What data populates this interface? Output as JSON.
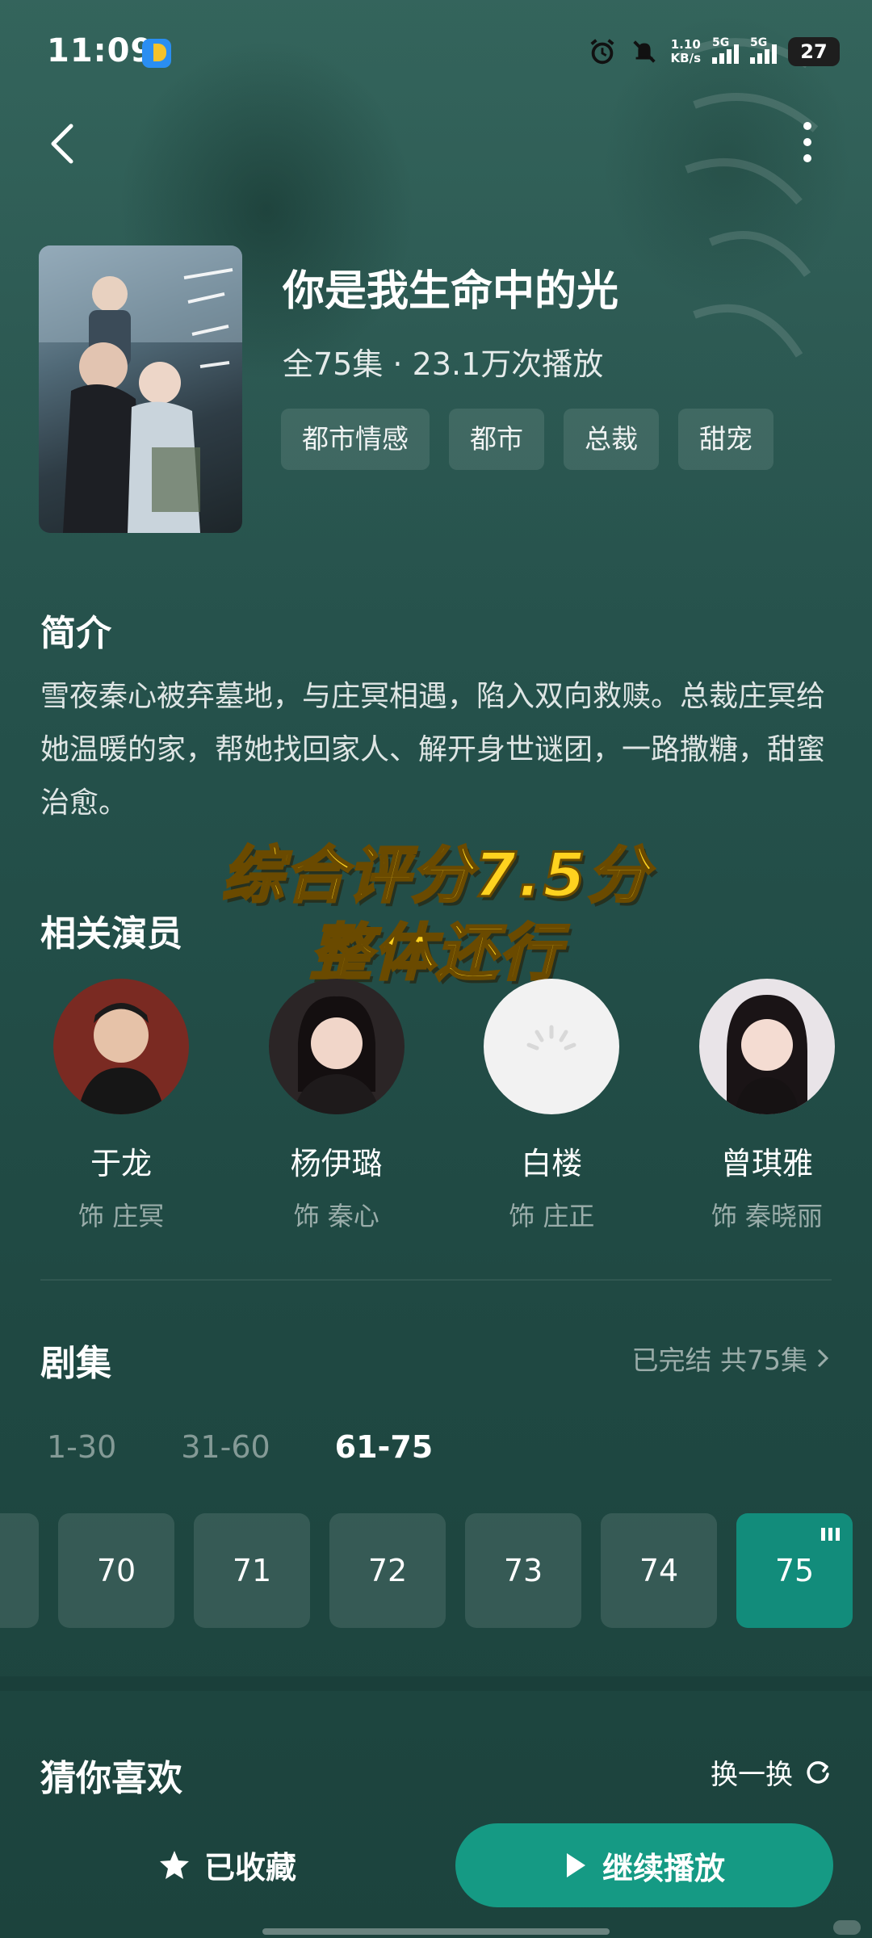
{
  "status_bar": {
    "time": "11:09",
    "net_speed_value": "1.10",
    "net_speed_unit": "KB/s",
    "signal1_label": "5G",
    "signal2_label": "5G",
    "battery": "27"
  },
  "drama": {
    "title": "你是我生命中的光",
    "meta": "全75集 · 23.1万次播放",
    "tags": [
      "都市情感",
      "都市",
      "总裁",
      "甜宠"
    ]
  },
  "synopsis": {
    "title": "简介",
    "text": "雪夜秦心被弃墓地，与庄冥相遇，陷入双向救赎。总裁庄冥给她温暖的家，帮她找回家人、解开身世谜团，一路撒糖，甜蜜治愈。"
  },
  "overlay": {
    "line1": "综合评分7.5分",
    "line2": "整体还行"
  },
  "cast": {
    "title": "相关演员",
    "members": [
      {
        "name": "于龙",
        "role": "饰 庄冥"
      },
      {
        "name": "杨伊璐",
        "role": "饰 秦心"
      },
      {
        "name": "白楼",
        "role": "饰 庄正"
      },
      {
        "name": "曾琪雅",
        "role": "饰 秦晓丽"
      }
    ]
  },
  "episodes": {
    "title": "剧集",
    "status": "已完结 共75集",
    "ranges": [
      "1-30",
      "31-60",
      "61-75"
    ],
    "active_range": "61-75",
    "visible": [
      "70",
      "71",
      "72",
      "73",
      "74",
      "75"
    ],
    "current": "75"
  },
  "recommend": {
    "title": "猜你喜欢",
    "refresh_label": "换一换"
  },
  "bottom": {
    "favorite_label": "已收藏",
    "play_label": "继续播放"
  },
  "colors": {
    "background": "#24504a",
    "accent": "#159a84",
    "caption": "#ffd21f"
  }
}
